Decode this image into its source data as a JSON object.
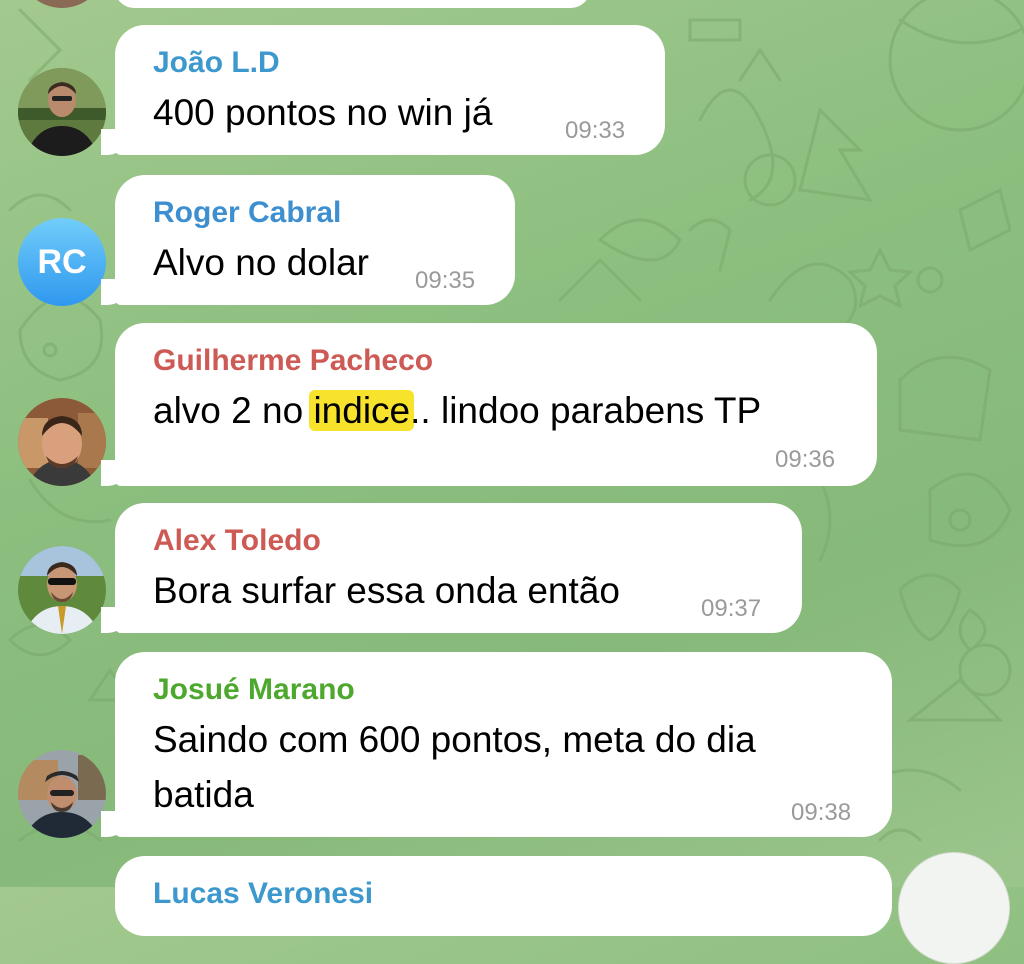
{
  "colors": {
    "chat_background": "#8cbf7f",
    "bubble": "#ffffff",
    "timestamp": "#9a9a9a",
    "highlight": "#f7e22c"
  },
  "messages": [
    {
      "sender": "João L.D",
      "sender_color": "#3d98cd",
      "lines": [
        "400 pontos no win já"
      ],
      "time": "09:33",
      "avatar": "photo"
    },
    {
      "sender": "Roger Cabral",
      "sender_color": "#3d8fd0",
      "lines": [
        "Alvo no dolar"
      ],
      "time": "09:35",
      "avatar": "initials",
      "initials": "RC"
    },
    {
      "sender": "Guilherme Pacheco",
      "sender_color": "#cd5a54",
      "text_before": "alvo 2 no ",
      "highlight": "indice",
      "text_after": ".. lindoo parabens TP",
      "time": "09:36",
      "avatar": "photo"
    },
    {
      "sender": "Alex Toledo",
      "sender_color": "#cd5a54",
      "lines": [
        "Bora surfar essa onda então"
      ],
      "time": "09:37",
      "avatar": "photo"
    },
    {
      "sender": "Josué Marano",
      "sender_color": "#4ea82e",
      "lines": [
        "Saindo com 600 pontos, meta do dia",
        "batida"
      ],
      "time": "09:38",
      "avatar": "photo"
    },
    {
      "sender": "Lucas Veronesi",
      "sender_color": "#3d98cd",
      "partial": true
    }
  ]
}
